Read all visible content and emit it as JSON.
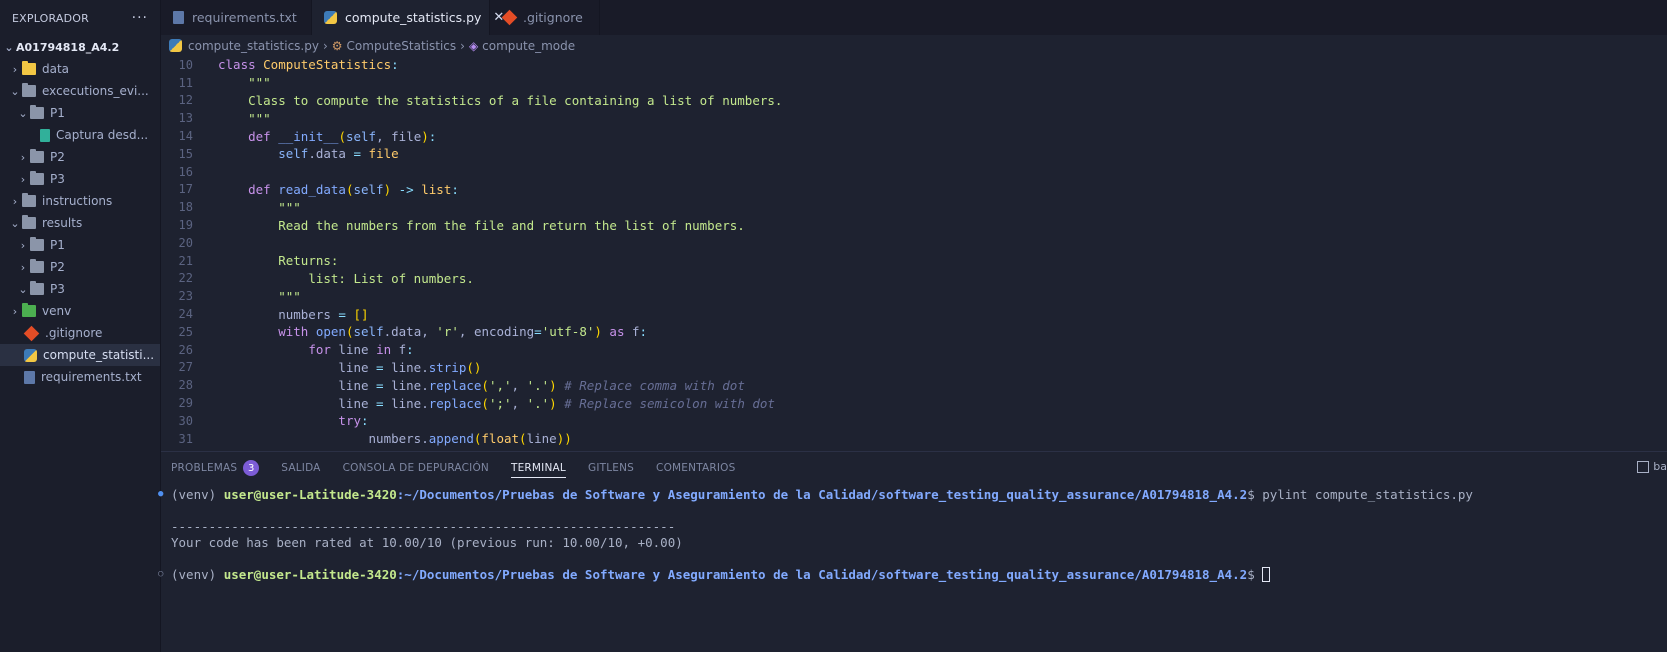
{
  "sidebar": {
    "title": "EXPLORADOR",
    "more": "···",
    "project": "A01794818_A4.2",
    "items": [
      {
        "label": "data",
        "chev": "›",
        "indent": 8,
        "icon": "folder-data-icon"
      },
      {
        "label": "excecutions_evi...",
        "chev": "⌄",
        "indent": 8,
        "icon": "folder-open-icon"
      },
      {
        "label": "P1",
        "chev": "⌄",
        "indent": 16,
        "icon": "folder-open-icon"
      },
      {
        "label": "Captura desd...",
        "chev": "",
        "indent": 40,
        "icon": "image-file-icon"
      },
      {
        "label": "P2",
        "chev": "›",
        "indent": 16,
        "icon": "folder-icon"
      },
      {
        "label": "P3",
        "chev": "›",
        "indent": 16,
        "icon": "folder-icon"
      },
      {
        "label": "instructions",
        "chev": "›",
        "indent": 8,
        "icon": "folder-icon"
      },
      {
        "label": "results",
        "chev": "⌄",
        "indent": 8,
        "icon": "folder-open-icon"
      },
      {
        "label": "P1",
        "chev": "›",
        "indent": 16,
        "icon": "folder-icon"
      },
      {
        "label": "P2",
        "chev": "›",
        "indent": 16,
        "icon": "folder-icon"
      },
      {
        "label": "P3",
        "chev": "⌄",
        "indent": 16,
        "icon": "folder-open-icon"
      },
      {
        "label": "venv",
        "chev": "›",
        "indent": 8,
        "icon": "folder-venv-icon"
      },
      {
        "label": ".gitignore",
        "chev": "",
        "indent": 24,
        "icon": "git-icon"
      },
      {
        "label": "compute_statisti...",
        "chev": "",
        "indent": 24,
        "icon": "python-icon",
        "selected": true
      },
      {
        "label": "requirements.txt",
        "chev": "",
        "indent": 24,
        "icon": "requirements-icon"
      }
    ]
  },
  "tabs": [
    {
      "label": "requirements.txt",
      "icon": "requirements-icon",
      "active": false
    },
    {
      "label": "compute_statistics.py",
      "icon": "python-icon",
      "active": true,
      "close": "✕"
    },
    {
      "label": ".gitignore",
      "icon": "git-icon",
      "active": false
    }
  ],
  "breadcrumb": {
    "file": "compute_statistics.py",
    "class": "ComputeStatistics",
    "method": "compute_mode"
  },
  "editor": {
    "lines": [
      {
        "n": "10",
        "tokens": [
          [
            "kw",
            "class "
          ],
          [
            "cls",
            "ComputeStatistics"
          ],
          [
            "op",
            ":"
          ]
        ]
      },
      {
        "n": "11",
        "tokens": [
          [
            "code",
            "    "
          ],
          [
            "str",
            "\"\"\""
          ]
        ]
      },
      {
        "n": "12",
        "tokens": [
          [
            "code",
            "    "
          ],
          [
            "str",
            "Class to compute the statistics of a file containing a list of numbers."
          ]
        ]
      },
      {
        "n": "13",
        "tokens": [
          [
            "code",
            "    "
          ],
          [
            "str",
            "\"\"\""
          ]
        ]
      },
      {
        "n": "14",
        "tokens": [
          [
            "code",
            "    "
          ],
          [
            "kw",
            "def "
          ],
          [
            "fn",
            "__init__"
          ],
          [
            "br",
            "("
          ],
          [
            "self",
            "self"
          ],
          [
            "code",
            ", "
          ],
          [
            "code",
            "file"
          ],
          [
            "br",
            ")"
          ],
          [
            "op",
            ":"
          ]
        ]
      },
      {
        "n": "15",
        "tokens": [
          [
            "code",
            "        "
          ],
          [
            "self",
            "self"
          ],
          [
            "code",
            ".data "
          ],
          [
            "op",
            "="
          ],
          [
            "code",
            " "
          ],
          [
            "cls",
            "file"
          ]
        ]
      },
      {
        "n": "16",
        "tokens": [
          [
            "code",
            ""
          ]
        ]
      },
      {
        "n": "17",
        "tokens": [
          [
            "code",
            "    "
          ],
          [
            "kw",
            "def "
          ],
          [
            "fn",
            "read_data"
          ],
          [
            "br",
            "("
          ],
          [
            "self",
            "self"
          ],
          [
            "br",
            ")"
          ],
          [
            "code",
            " "
          ],
          [
            "op",
            "->"
          ],
          [
            "code",
            " "
          ],
          [
            "cls",
            "list"
          ],
          [
            "op",
            ":"
          ]
        ]
      },
      {
        "n": "18",
        "tokens": [
          [
            "code",
            "        "
          ],
          [
            "str",
            "\"\"\""
          ]
        ]
      },
      {
        "n": "19",
        "tokens": [
          [
            "code",
            "        "
          ],
          [
            "str",
            "Read the numbers from the file and return the list of numbers."
          ]
        ]
      },
      {
        "n": "20",
        "tokens": [
          [
            "code",
            ""
          ]
        ]
      },
      {
        "n": "21",
        "tokens": [
          [
            "code",
            "        "
          ],
          [
            "str",
            "Returns:"
          ]
        ]
      },
      {
        "n": "22",
        "tokens": [
          [
            "code",
            "            "
          ],
          [
            "str",
            "list: List of numbers."
          ]
        ]
      },
      {
        "n": "23",
        "tokens": [
          [
            "code",
            "        "
          ],
          [
            "str",
            "\"\"\""
          ]
        ]
      },
      {
        "n": "24",
        "tokens": [
          [
            "code",
            "        numbers "
          ],
          [
            "op",
            "="
          ],
          [
            "code",
            " "
          ],
          [
            "br",
            "[]"
          ]
        ]
      },
      {
        "n": "25",
        "tokens": [
          [
            "code",
            "        "
          ],
          [
            "kw",
            "with "
          ],
          [
            "fn",
            "open"
          ],
          [
            "br",
            "("
          ],
          [
            "self",
            "self"
          ],
          [
            "code",
            ".data, "
          ],
          [
            "str",
            "'r'"
          ],
          [
            "code",
            ", "
          ],
          [
            "code",
            "encoding"
          ],
          [
            "op",
            "="
          ],
          [
            "str",
            "'utf-8'"
          ],
          [
            "br",
            ")"
          ],
          [
            "kw",
            " as "
          ],
          [
            "code",
            "f"
          ],
          [
            "op",
            ":"
          ]
        ]
      },
      {
        "n": "26",
        "tokens": [
          [
            "code",
            "            "
          ],
          [
            "kw",
            "for "
          ],
          [
            "code",
            "line "
          ],
          [
            "kw",
            "in "
          ],
          [
            "code",
            "f"
          ],
          [
            "op",
            ":"
          ]
        ]
      },
      {
        "n": "27",
        "tokens": [
          [
            "code",
            "                line "
          ],
          [
            "op",
            "="
          ],
          [
            "code",
            " line."
          ],
          [
            "fn",
            "strip"
          ],
          [
            "br",
            "()"
          ]
        ]
      },
      {
        "n": "28",
        "tokens": [
          [
            "code",
            "                line "
          ],
          [
            "op",
            "="
          ],
          [
            "code",
            " line."
          ],
          [
            "fn",
            "replace"
          ],
          [
            "br",
            "("
          ],
          [
            "str",
            "','"
          ],
          [
            "code",
            ", "
          ],
          [
            "str",
            "'.'"
          ],
          [
            "br",
            ")"
          ],
          [
            "code",
            " "
          ],
          [
            "cm",
            "# Replace comma with dot"
          ]
        ]
      },
      {
        "n": "29",
        "tokens": [
          [
            "code",
            "                line "
          ],
          [
            "op",
            "="
          ],
          [
            "code",
            " line."
          ],
          [
            "fn",
            "replace"
          ],
          [
            "br",
            "("
          ],
          [
            "str",
            "';'"
          ],
          [
            "code",
            ", "
          ],
          [
            "str",
            "'.'"
          ],
          [
            "br",
            ")"
          ],
          [
            "code",
            " "
          ],
          [
            "cm",
            "# Replace semicolon with dot"
          ]
        ]
      },
      {
        "n": "30",
        "tokens": [
          [
            "code",
            "                "
          ],
          [
            "kw",
            "try"
          ],
          [
            "op",
            ":"
          ]
        ]
      },
      {
        "n": "31",
        "tokens": [
          [
            "code",
            "                    numbers."
          ],
          [
            "fn",
            "append"
          ],
          [
            "br",
            "("
          ],
          [
            "cls",
            "float"
          ],
          [
            "br",
            "("
          ],
          [
            "code",
            "line"
          ],
          [
            "br",
            "))"
          ]
        ]
      }
    ]
  },
  "panel": {
    "tabs": [
      {
        "label": "PROBLEMAS",
        "badge": "3"
      },
      {
        "label": "SALIDA"
      },
      {
        "label": "CONSOLA DE DEPURACIÓN"
      },
      {
        "label": "TERMINAL",
        "active": true
      },
      {
        "label": "GITLENS"
      },
      {
        "label": "COMENTARIOS"
      }
    ],
    "right_label": "ba"
  },
  "terminal": {
    "prompt_env": "(venv) ",
    "prompt_user": "user@user-Latitude-3420",
    "prompt_path": ":~/Documentos/Pruebas de Software y Aseguramiento de la Calidad/software_testing_quality_assurance/A01794818_A4.2",
    "command": "$ pylint compute_statistics.py",
    "separator": "-------------------------------------------------------------------",
    "rating": "Your code has been rated at 10.00/10 (previous run: 10.00/10, +0.00)",
    "prompt_end": "$ "
  }
}
